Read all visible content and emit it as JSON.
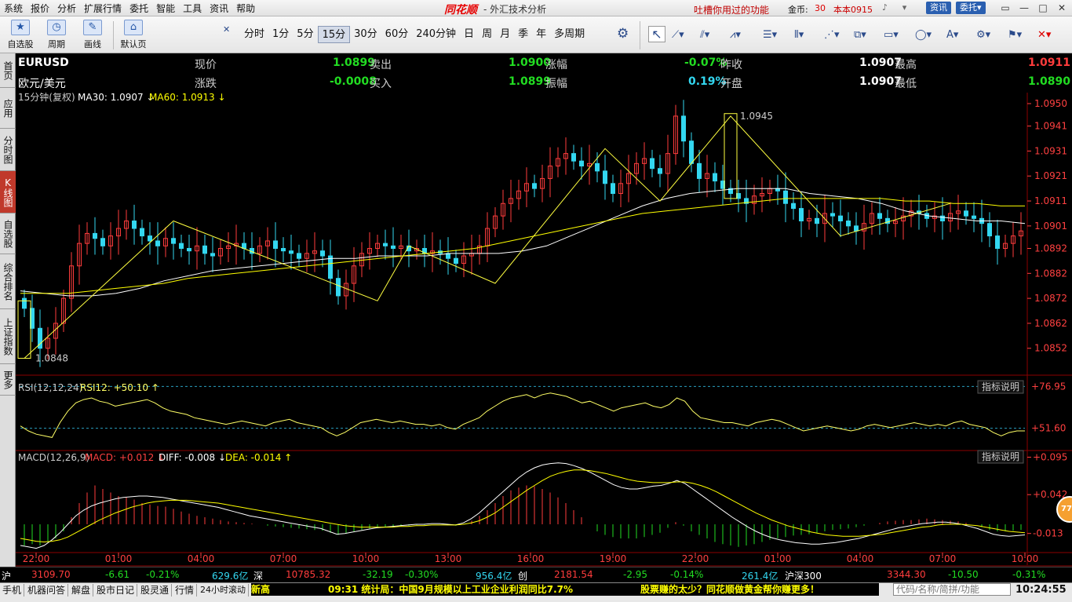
{
  "menu": [
    "系统",
    "报价",
    "分析",
    "扩展行情",
    "委托",
    "智能",
    "工具",
    "资讯",
    "帮助"
  ],
  "app": {
    "logo": "同花顺",
    "title": "- 外汇技术分析",
    "promo": "吐槽你用过的功能",
    "coins_label": "金币:",
    "coins_value": "30",
    "version": "本本0915",
    "btn_news": "资讯",
    "btn_trade": "委托▾"
  },
  "toolbar": {
    "tools": [
      {
        "label": "自选股",
        "icon": "star-icon"
      },
      {
        "label": "周期",
        "icon": "clock-icon"
      },
      {
        "label": "画线",
        "icon": "pen-icon"
      },
      {
        "label": "默认页",
        "icon": "home-icon"
      }
    ],
    "periods": [
      "分时",
      "1分",
      "5分",
      "15分",
      "30分",
      "60分",
      "240分钟",
      "日",
      "周",
      "月",
      "季",
      "年",
      "多周期"
    ],
    "active_period": "15分"
  },
  "sidebar": [
    "首页",
    "应用",
    "分时图",
    "K线图",
    "自选股",
    "综合排名",
    "上证指数",
    "更多"
  ],
  "sidebar_active": "K线图",
  "quote": {
    "code": "EURUSD",
    "name": "欧元/美元",
    "labels": [
      "现价",
      "涨跌",
      "卖出",
      "买入",
      "涨幅",
      "振幅",
      "昨收",
      "开盘",
      "最高",
      "最低"
    ],
    "current": "1.0899",
    "change": "-0.0008",
    "sell": "1.0900",
    "buy": "1.0899",
    "pct_change": "-0.07%",
    "amplitude": "0.19%",
    "prev_close": "1.0907",
    "open": "1.0907",
    "high": "1.0911",
    "low": "1.0890"
  },
  "indicator": {
    "period_label": "15分钟(复权)",
    "ma30_label": "MA30: 1.0907",
    "ma60_label": "MA60: 1.0913",
    "rsi_label": "RSI(12,12,24)",
    "rsi12_label": "RSI12: +50.10",
    "macd_label": "MACD(12,26,9)",
    "macd_val": "MACD: +0.012",
    "diff_val": "DIFF: -0.008",
    "dea_val": "DEA: -0.014",
    "explain_btn": "指标说明"
  },
  "colors": {
    "up": "#ff3c3c",
    "down": "#33d7f0",
    "ma30": "#ffffff",
    "ma60": "#ffff00",
    "grid": "#8b0000",
    "axis_text": "#ff4040",
    "rsi_line": "#ffff66",
    "macd_up": "#ff3c3c",
    "macd_down": "#22dd22"
  },
  "chart_data": [
    {
      "type": "candlestick",
      "ylim": [
        1.0845,
        1.095
      ],
      "yticks": [
        "1.0950",
        "1.0941",
        "1.0931",
        "1.0921",
        "1.0911",
        "1.0901",
        "1.0892",
        "1.0882",
        "1.0872",
        "1.0862",
        "1.0852"
      ],
      "xticks": [
        "22:00",
        "01:00",
        "04:00",
        "07:00",
        "10:00",
        "13:00",
        "16:00",
        "19:00",
        "22:00",
        "01:00",
        "04:00",
        "07:00",
        "10:00"
      ],
      "high_mark": "1.0945",
      "low_mark": "1.0848",
      "close_path": [
        1.0868,
        1.086,
        1.0852,
        1.0856,
        1.0862,
        1.0872,
        1.0885,
        1.0894,
        1.0898,
        1.0896,
        1.0893,
        1.0897,
        1.09,
        1.0903,
        1.09,
        1.0897,
        1.0895,
        1.0893,
        1.0896,
        1.0894,
        1.0892,
        1.0891,
        1.0893,
        1.089,
        1.0889,
        1.0892,
        1.0893,
        1.0894,
        1.0892,
        1.089,
        1.0893,
        1.0895,
        1.0892,
        1.0891,
        1.089,
        1.0888,
        1.089,
        1.0891,
        1.0889,
        1.088,
        1.0873,
        1.0878,
        1.0885,
        1.089,
        1.0892,
        1.0894,
        1.0893,
        1.0892,
        1.0893,
        1.0891,
        1.0892,
        1.089,
        1.0891,
        1.089,
        1.0888,
        1.0886,
        1.0889,
        1.089,
        1.0893,
        1.09,
        1.0905,
        1.091,
        1.0912,
        1.0915,
        1.0918,
        1.0916,
        1.092,
        1.0925,
        1.0928,
        1.093,
        1.0927,
        1.0925,
        1.0926,
        1.0923,
        1.0918,
        1.0914,
        1.0918,
        1.0922,
        1.0926,
        1.0928,
        1.0924,
        1.0922,
        1.093,
        1.0945,
        1.0935,
        1.0926,
        1.092,
        1.0922,
        1.0919,
        1.0916,
        1.0914,
        1.0912,
        1.091,
        1.0913,
        1.0914,
        1.0916,
        1.0915,
        1.091,
        1.0908,
        1.0903,
        1.0904,
        1.0902,
        1.0906,
        1.0905,
        1.0903,
        1.0901,
        1.0899,
        1.0902,
        1.0906,
        1.0904,
        1.0902,
        1.0903,
        1.0905,
        1.0907,
        1.0906,
        1.0904,
        1.0905,
        1.0903,
        1.0906,
        1.0907,
        1.0905,
        1.0904,
        1.0902,
        1.0897,
        1.0892,
        1.0894,
        1.0897,
        1.0899
      ],
      "ma30": [
        1.0875,
        1.0874,
        1.0873,
        1.0873,
        1.0874,
        1.0876,
        1.0879,
        1.0881,
        1.0883,
        1.0884,
        1.0885,
        1.0886,
        1.0887,
        1.0888,
        1.0888,
        1.0889,
        1.0889,
        1.0889,
        1.089,
        1.089,
        1.089,
        1.0891,
        1.0893,
        1.0897,
        1.0901,
        1.0905,
        1.0909,
        1.0912,
        1.0914,
        1.0915,
        1.0916,
        1.0916,
        1.0916,
        1.0914,
        1.0913,
        1.0912,
        1.091,
        1.0907,
        1.0905,
        1.0904,
        1.0903,
        1.0903,
        1.0902
      ],
      "ma60": [
        1.0874,
        1.0874,
        1.0874,
        1.0875,
        1.0876,
        1.0877,
        1.0878,
        1.088,
        1.0881,
        1.0882,
        1.0883,
        1.0884,
        1.0885,
        1.0886,
        1.0887,
        1.0888,
        1.0889,
        1.089,
        1.0891,
        1.0892,
        1.0894,
        1.0896,
        1.0898,
        1.09,
        1.0902,
        1.0904,
        1.0906,
        1.0907,
        1.0908,
        1.0909,
        1.091,
        1.0911,
        1.0912,
        1.0912,
        1.0912,
        1.0912,
        1.0912,
        1.0911,
        1.0911,
        1.091,
        1.091,
        1.0909,
        1.0909
      ],
      "zigzag": [
        [
          0,
          1.0848
        ],
        [
          19,
          1.0903
        ],
        [
          45,
          1.0871
        ],
        [
          49,
          1.0893
        ],
        [
          60,
          1.0878
        ],
        [
          74,
          1.0932
        ],
        [
          81,
          1.0911
        ],
        [
          90,
          1.0945
        ],
        [
          104,
          1.0897
        ],
        [
          118,
          1.091
        ]
      ]
    },
    {
      "type": "line",
      "title": "RSI(12,12,24)",
      "ylim": [
        40,
        80
      ],
      "yticks": [
        "+76.95",
        "+51.60"
      ],
      "values": [
        53,
        50,
        48,
        47,
        46,
        55,
        62,
        67,
        69,
        70,
        68,
        67,
        65,
        66,
        67,
        68,
        69,
        67,
        64,
        62,
        61,
        60,
        58,
        57,
        56,
        55,
        54,
        55,
        56,
        55,
        54,
        53,
        55,
        56,
        57,
        55,
        54,
        53,
        52,
        49,
        47,
        49,
        52,
        55,
        56,
        57,
        56,
        55,
        56,
        55,
        54,
        54,
        53,
        54,
        52,
        51,
        54,
        56,
        58,
        62,
        65,
        68,
        70,
        71,
        72,
        70,
        72,
        73,
        72,
        71,
        69,
        67,
        68,
        66,
        64,
        62,
        64,
        65,
        66,
        67,
        65,
        64,
        66,
        70,
        68,
        62,
        58,
        57,
        56,
        55,
        55,
        54,
        53,
        55,
        56,
        57,
        56,
        54,
        52,
        50,
        51,
        52,
        53,
        52,
        51,
        50,
        51,
        53,
        54,
        53,
        52,
        53,
        54,
        55,
        54,
        53,
        54,
        53,
        55,
        56,
        54,
        53,
        52,
        49,
        47,
        49,
        50,
        50
      ]
    },
    {
      "type": "bar",
      "title": "MACD(12,26,9)",
      "ylim": [
        -0.04,
        0.1
      ],
      "yticks": [
        "+0.095",
        "+0.042",
        "-0.013"
      ],
      "histogram": [
        -0.03,
        -0.028,
        -0.03,
        -0.025,
        -0.02,
        -0.01,
        0.01,
        0.03,
        0.045,
        0.055,
        0.05,
        0.045,
        0.04,
        0.038,
        0.035,
        0.03,
        0.028,
        0.026,
        0.025,
        0.022,
        0.018,
        0.015,
        0.012,
        0.01,
        0.008,
        0.006,
        0.004,
        0.003,
        0.002,
        0.001,
        0.0,
        -0.002,
        -0.003,
        -0.004,
        -0.005,
        -0.006,
        -0.007,
        -0.008,
        -0.009,
        -0.012,
        -0.015,
        -0.013,
        -0.01,
        -0.008,
        -0.006,
        -0.005,
        -0.004,
        -0.003,
        -0.002,
        -0.002,
        -0.001,
        -0.001,
        0.0,
        0.0,
        -0.001,
        -0.002,
        0.0,
        0.005,
        0.012,
        0.02,
        0.03,
        0.04,
        0.048,
        0.052,
        0.055,
        0.054,
        0.05,
        0.045,
        0.038,
        0.03,
        0.02,
        0.01,
        0.0,
        -0.01,
        -0.015,
        -0.018,
        -0.02,
        -0.02,
        -0.02,
        -0.018,
        -0.015,
        -0.012,
        -0.005,
        0.003,
        -0.002,
        -0.01,
        -0.015,
        -0.02,
        -0.025,
        -0.028,
        -0.03,
        -0.032,
        -0.03,
        -0.028,
        -0.025,
        -0.022,
        -0.02,
        -0.018,
        -0.016,
        -0.015,
        -0.014,
        -0.012,
        -0.01,
        -0.008,
        -0.007,
        -0.006,
        -0.004,
        -0.002,
        0.0,
        0.002,
        0.004,
        0.005,
        0.006,
        0.006,
        0.007,
        0.008,
        0.007,
        0.006,
        0.005,
        0.004,
        0.002,
        0.0,
        -0.004,
        -0.008,
        -0.01,
        -0.01,
        -0.009,
        -0.008
      ],
      "diff": [
        -0.03,
        -0.032,
        -0.034,
        -0.03,
        -0.022,
        -0.012,
        0.0,
        0.012,
        0.02,
        0.026,
        0.03,
        0.033,
        0.036,
        0.038,
        0.039,
        0.04,
        0.04,
        0.039,
        0.038,
        0.036,
        0.034,
        0.032,
        0.03,
        0.028,
        0.026,
        0.024,
        0.021,
        0.018,
        0.015,
        0.012,
        0.01,
        0.008,
        0.006,
        0.004,
        0.002,
        0.0,
        -0.002,
        -0.004,
        -0.006,
        -0.01,
        -0.014,
        -0.013,
        -0.011,
        -0.009,
        -0.007,
        -0.005,
        -0.004,
        -0.003,
        -0.002,
        -0.001,
        0.0,
        0.0,
        0.001,
        0.001,
        0.0,
        -0.001,
        0.002,
        0.008,
        0.016,
        0.026,
        0.036,
        0.046,
        0.056,
        0.066,
        0.074,
        0.08,
        0.084,
        0.086,
        0.087,
        0.086,
        0.083,
        0.079,
        0.074,
        0.068,
        0.062,
        0.056,
        0.052,
        0.05,
        0.05,
        0.052,
        0.054,
        0.055,
        0.058,
        0.062,
        0.058,
        0.05,
        0.042,
        0.034,
        0.026,
        0.018,
        0.01,
        0.003,
        -0.004,
        -0.01,
        -0.015,
        -0.019,
        -0.022,
        -0.024,
        -0.026,
        -0.027,
        -0.028,
        -0.028,
        -0.027,
        -0.026,
        -0.024,
        -0.022,
        -0.02,
        -0.017,
        -0.014,
        -0.011,
        -0.008,
        -0.005,
        -0.003,
        -0.001,
        0.001,
        0.002,
        0.003,
        0.003,
        0.002,
        0.0,
        -0.003,
        -0.006,
        -0.01,
        -0.014,
        -0.016,
        -0.017,
        -0.016,
        -0.015
      ],
      "dea": [
        -0.02,
        -0.022,
        -0.024,
        -0.025,
        -0.024,
        -0.022,
        -0.018,
        -0.012,
        -0.006,
        0.0,
        0.006,
        0.011,
        0.016,
        0.02,
        0.024,
        0.027,
        0.03,
        0.032,
        0.033,
        0.034,
        0.034,
        0.034,
        0.033,
        0.032,
        0.031,
        0.03,
        0.028,
        0.026,
        0.024,
        0.022,
        0.02,
        0.018,
        0.016,
        0.014,
        0.012,
        0.01,
        0.008,
        0.006,
        0.004,
        0.002,
        0.0,
        -0.002,
        -0.003,
        -0.004,
        -0.004,
        -0.004,
        -0.004,
        -0.004,
        -0.003,
        -0.003,
        -0.002,
        -0.002,
        -0.001,
        -0.001,
        -0.001,
        -0.001,
        0.0,
        0.002,
        0.005,
        0.01,
        0.016,
        0.024,
        0.032,
        0.04,
        0.048,
        0.055,
        0.062,
        0.068,
        0.072,
        0.075,
        0.077,
        0.077,
        0.076,
        0.074,
        0.072,
        0.069,
        0.066,
        0.063,
        0.061,
        0.06,
        0.059,
        0.059,
        0.059,
        0.06,
        0.06,
        0.058,
        0.055,
        0.051,
        0.046,
        0.04,
        0.034,
        0.028,
        0.022,
        0.016,
        0.011,
        0.006,
        0.002,
        -0.002,
        -0.005,
        -0.008,
        -0.011,
        -0.013,
        -0.015,
        -0.016,
        -0.017,
        -0.017,
        -0.017,
        -0.016,
        -0.015,
        -0.014,
        -0.012,
        -0.01,
        -0.008,
        -0.006,
        -0.004,
        -0.003,
        -0.001,
        0.0,
        0.0,
        0.0,
        -0.001,
        -0.002,
        -0.004,
        -0.006,
        -0.008,
        -0.01,
        -0.011,
        -0.012
      ]
    }
  ],
  "status": [
    {
      "name": "沪",
      "value": "3109.70",
      "change": "-6.61",
      "pct": "-0.21%",
      "amount": "629.6亿"
    },
    {
      "name": "深",
      "value": "10785.32",
      "change": "-32.19",
      "pct": "-0.30%",
      "amount": "956.4亿"
    },
    {
      "name": "创",
      "value": "2181.54",
      "change": "-2.95",
      "pct": "-0.14%",
      "amount": "261.4亿"
    },
    {
      "name": "沪深300",
      "value": "3344.30",
      "change": "-10.50",
      "pct": "-0.31%"
    }
  ],
  "bottom": {
    "tabs": [
      "手机",
      "机器问答",
      "解盘",
      "股市日记",
      "股灵通",
      "行情",
      "24小时滚动",
      "新高"
    ],
    "ticker": "09:31 统计局：中国9月规模以上工业企业利润同比7.7%",
    "ticker2": "股票赚的太少？同花顺做黄金帮你赚更多！",
    "input_placeholder": "代码/名称/简拼/功能",
    "clock": "10:24:55"
  },
  "badge": "77"
}
